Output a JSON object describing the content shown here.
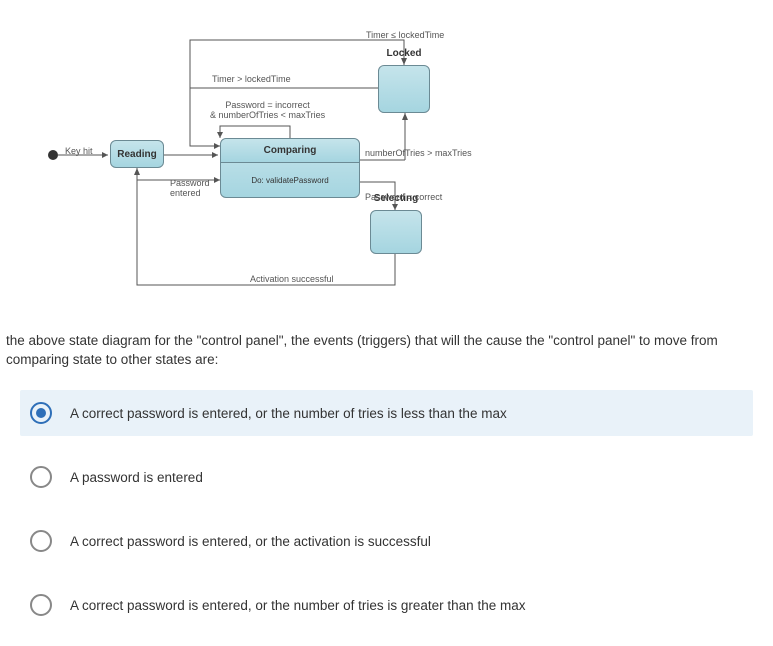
{
  "diagram": {
    "states": {
      "reading": "Reading",
      "comparing_header": "Comparing",
      "comparing_body": "Do: validatePassword",
      "locked": "Locked",
      "selecting": "Selecting"
    },
    "labels": {
      "key_hit": "Key hit",
      "timer_gt": "Timer > lockedTime",
      "timer_lt": "Timer ≤ lockedTime",
      "pass_incorrect_1": "Password = incorrect",
      "pass_incorrect_2": "& numberOfTries < maxTries",
      "number_gt": "numberOfTries > maxTries",
      "pass_entered_1": "Password",
      "pass_entered_2": "entered",
      "pass_correct": "Password = correct",
      "activation": "Activation successful"
    }
  },
  "question_text": "the above state diagram for the \"control panel\", the events (triggers) that will the cause the \"control panel\" to move from comparing state to other states are:",
  "options": [
    {
      "label": "A correct password is entered, or the number of tries is less than the max",
      "selected": true
    },
    {
      "label": "A password is entered",
      "selected": false
    },
    {
      "label": "A correct password is entered, or the activation is successful",
      "selected": false
    },
    {
      "label": "A correct password is entered, or the number of tries is greater than the max",
      "selected": false
    }
  ]
}
